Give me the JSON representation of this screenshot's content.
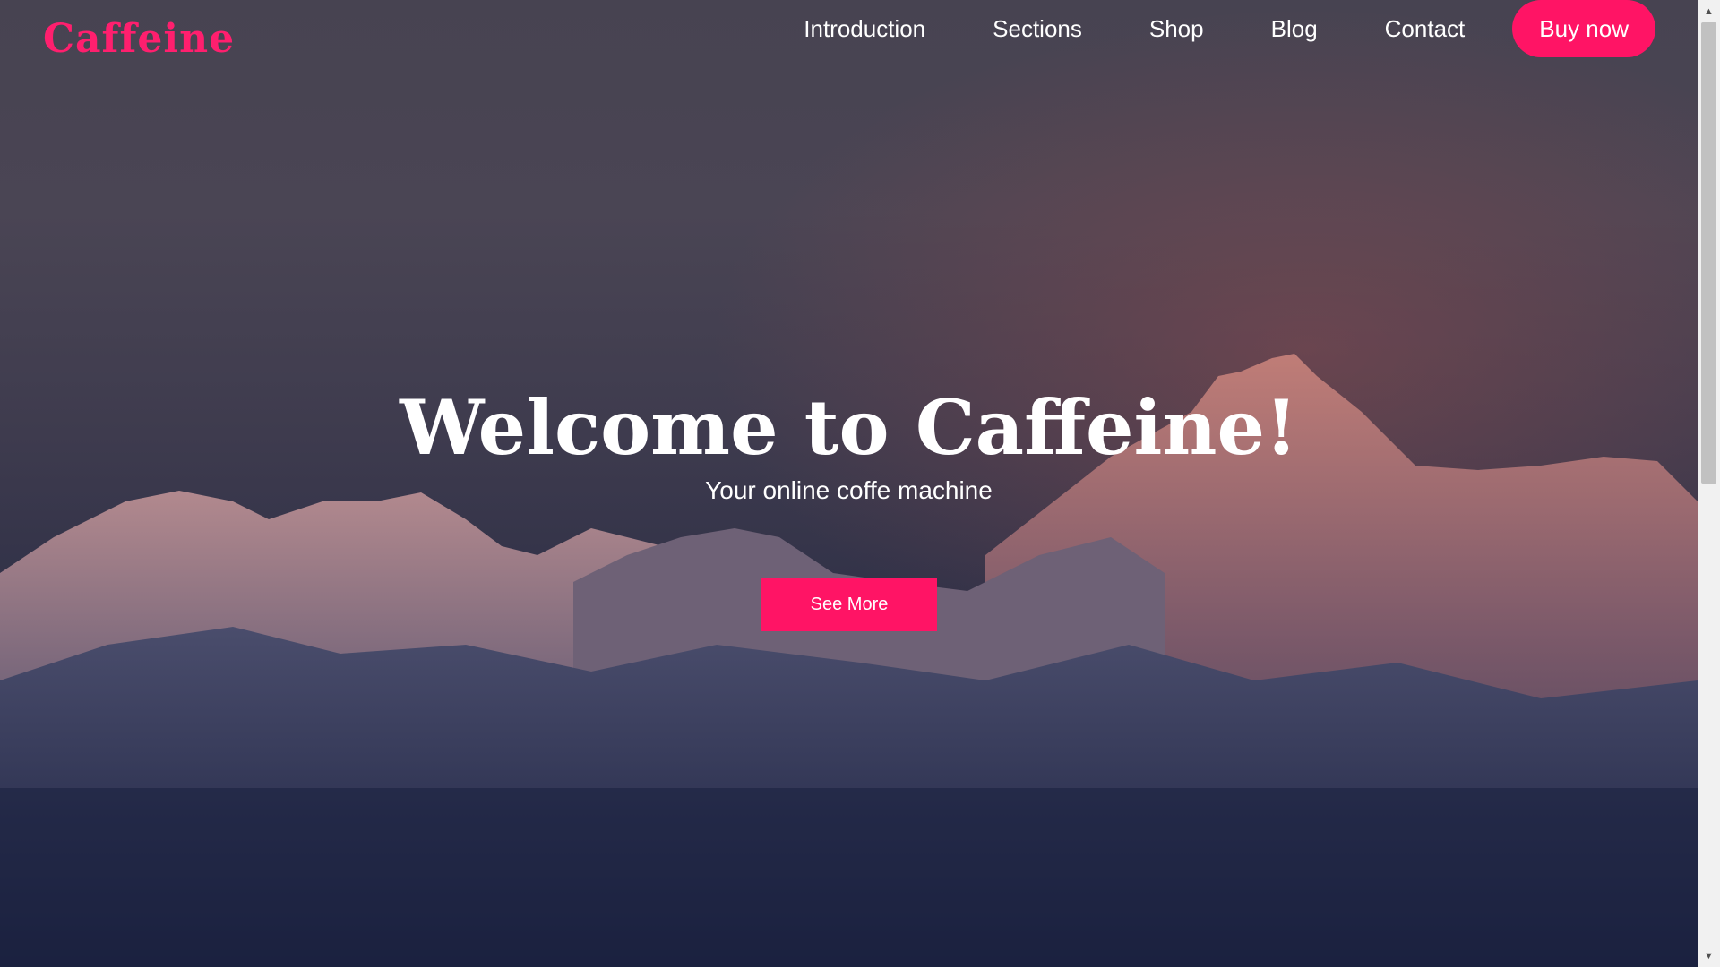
{
  "brand": {
    "logo": "Caffeine",
    "accent": "#ff1465"
  },
  "nav": {
    "items": [
      {
        "label": "Introduction"
      },
      {
        "label": "Sections"
      },
      {
        "label": "Shop"
      },
      {
        "label": "Blog"
      },
      {
        "label": "Contact"
      }
    ],
    "cta_label": "Buy now"
  },
  "hero": {
    "title": "Welcome to Caffeine!",
    "subtitle": "Your online coffe machine",
    "button_label": "See More",
    "background": "mountain-range-image"
  },
  "scrollbar": {
    "up_icon": "▲",
    "down_icon": "▼"
  }
}
